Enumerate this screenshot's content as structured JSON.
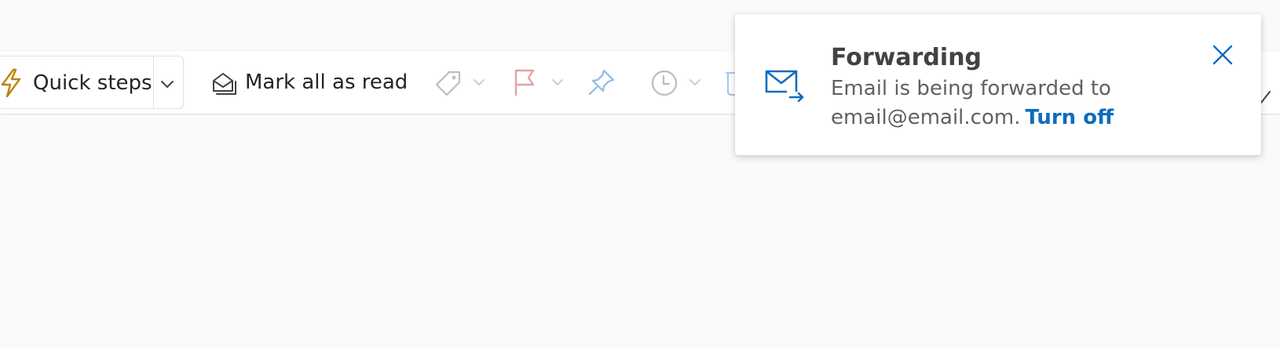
{
  "toolbar": {
    "quick_steps_label": "Quick steps",
    "mark_all_read_label": "Mark all as read",
    "icons": {
      "quick_steps": "lightning-bolt",
      "quick_steps_menu": "chevron-down",
      "mark_all_read": "envelope-open-stack",
      "categorize": "tag",
      "flag": "flag",
      "pin": "pin",
      "snooze": "clock",
      "more": "checkmark"
    }
  },
  "toast": {
    "title": "Forwarding",
    "message_line1": "Email is being forwarded to",
    "message_line2": "email@email.com.",
    "action_label": "Turn off",
    "icons": {
      "main": "envelope-forward",
      "close": "close"
    }
  },
  "colors": {
    "accent": "#0f6cbd",
    "bolt": "#b8860b",
    "flag": "#d13438",
    "page_background": "#fafafa"
  }
}
